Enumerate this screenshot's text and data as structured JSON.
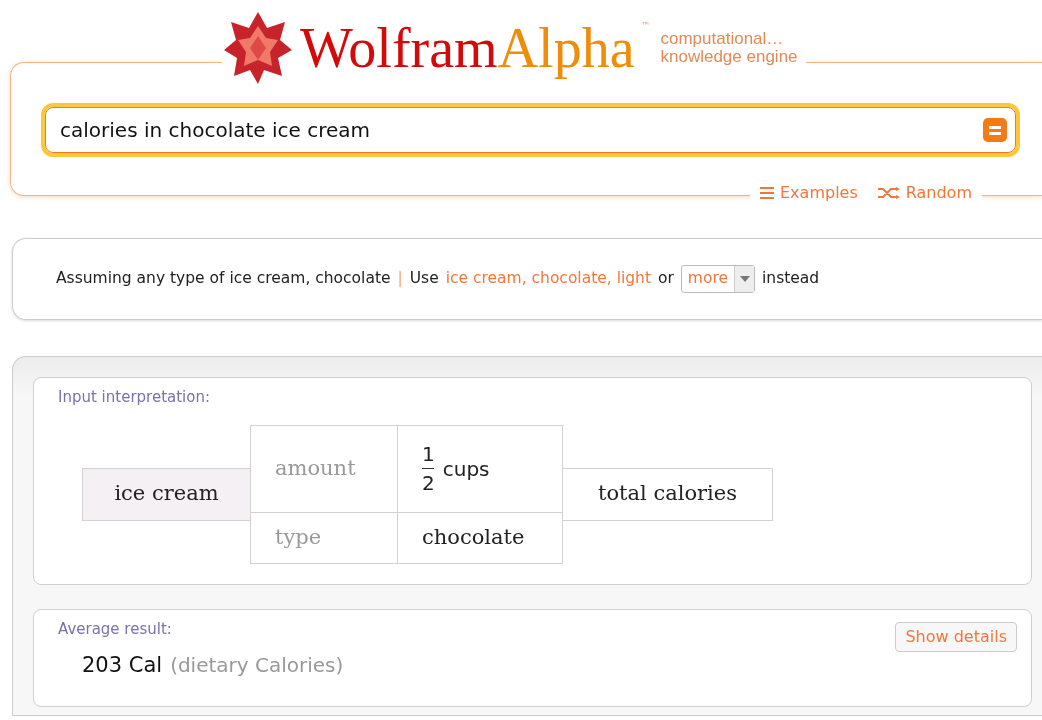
{
  "logo": {
    "word_1": "Wolfram",
    "word_2": "Alpha",
    "trademark": "™",
    "tagline_1": "computational…",
    "tagline_2": "knowledge engine"
  },
  "search": {
    "value": "calories in chocolate ice cream"
  },
  "search_links": [
    {
      "label": "Examples",
      "kind": "list"
    },
    {
      "label": "Random",
      "kind": "shuffle"
    }
  ],
  "assumption": {
    "text": "Assuming any type of ice cream, chocolate",
    "separator": "|",
    "use": "Use",
    "link": "ice cream, chocolate, light",
    "or": "or",
    "dropdown": "more",
    "instead": "instead"
  },
  "input_interpretation": {
    "title": "Input interpretation:",
    "food": "ice cream",
    "rows": [
      {
        "label": "amount",
        "numerator": "1",
        "denominator": "2",
        "unit": "cups"
      },
      {
        "label": "type",
        "value": "chocolate"
      }
    ],
    "property": "total calories"
  },
  "average_result": {
    "title": "Average result:",
    "button": "Show details",
    "value": "203 Cal",
    "unit_note": "(dietary Calories)"
  }
}
